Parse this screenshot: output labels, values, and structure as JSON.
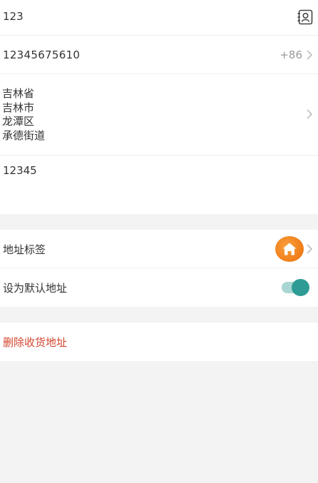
{
  "form": {
    "name_value": "123",
    "phone_value": "12345675610",
    "country_code": "+86",
    "region_lines": [
      "吉林省",
      "吉林市",
      "龙潭区",
      "承德街道"
    ],
    "detail_value": "12345"
  },
  "settings": {
    "tag_label": "地址标签",
    "tag_icon": "home-icon",
    "default_label": "设为默认地址",
    "default_enabled": true
  },
  "actions": {
    "delete_label": "删除收货地址"
  },
  "icons": {
    "contact": "contact-book-icon",
    "chevron": "chevron-right-icon"
  },
  "colors": {
    "delete_text": "#d4452e",
    "toggle_on": "#2e9c95",
    "tag_badge": "#f08a24"
  }
}
